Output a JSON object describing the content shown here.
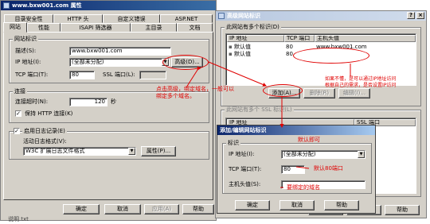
{
  "bg_window": {
    "title": "www.bxw001.com 属性",
    "tabs_row1": [
      "目录安全性",
      "HTTP 头",
      "自定义错误",
      "ASP.NET"
    ],
    "tabs_row2": [
      "网站",
      "性能",
      "ISAPI 筛选器",
      "主目录",
      "文档"
    ],
    "identity_group": "网站标识",
    "desc_label": "描述(S):",
    "desc_value": "www.bxw001.com",
    "ip_label": "IP 地址(I):",
    "ip_value": "(全部未分配)",
    "advanced_button": "高级(D)...",
    "tcp_label": "TCP 端口(T):",
    "tcp_value": "80",
    "ssl_label": "SSL 端口(L):",
    "ssl_value": "",
    "connection_group": "连接",
    "timeout_label": "连接超时(N):",
    "timeout_value": "120",
    "timeout_unit": "秒",
    "keepalive_label": "保持 HTTP 连接(K)",
    "logging_label": "启用日志记录(E)",
    "log_format_label": "活动日志格式(V):",
    "log_format_value": "W3C 扩展日志文件格式",
    "properties_button": "属性(P)...",
    "ok_button": "确定",
    "cancel_button": "取消",
    "apply_button": "应用(A)",
    "help_button": "帮助"
  },
  "advanced_window": {
    "title": "高级网站标识",
    "group1_label": "此网站有多个标识(D)",
    "columns": [
      "IP 地址",
      "TCP 端口",
      "主机头值"
    ],
    "rows": [
      {
        "ip": "默认值",
        "port": "80",
        "host": "www.bxw001.com"
      },
      {
        "ip": "默认值",
        "port": "80",
        "host": ""
      }
    ],
    "add_button": "添加(A)...",
    "remove_button": "删除(R)",
    "edit_button": "编辑(I)...",
    "group2_label": "此网站有多个 SSL 标识(L)",
    "ssl_columns": [
      "IP 地址",
      "SSL 端口"
    ],
    "ok_button": "确定",
    "cancel_button": "取消",
    "help_button": "帮助"
  },
  "edit_dialog": {
    "title": "添加/编辑网站标识",
    "group_label": "标识",
    "ip_label": "IP 地址(I):",
    "ip_value": "(全部未分配)",
    "tcp_label": "TCP 端口(T):",
    "tcp_value": "80",
    "host_label": "主机头值(S):",
    "host_value": "",
    "ok_button": "确定",
    "cancel_button": "取消",
    "help_button": "帮助"
  },
  "annotations": {
    "click_advanced": "点击高级，绑定域名，一般可以\n绑定多个域名。",
    "ip_note": "如果不懂，是可以通过IP地址访问\n根据自己的需求，是否设置IP访问",
    "default_ok": "默认即可",
    "default_port": "默认80端口",
    "bind_domain": "要绑定的域名"
  },
  "bottom_text": "说明.txt",
  "colors": {
    "annotation": "#e00000",
    "title_active": "#0a246a",
    "face": "#d4d0c8"
  }
}
